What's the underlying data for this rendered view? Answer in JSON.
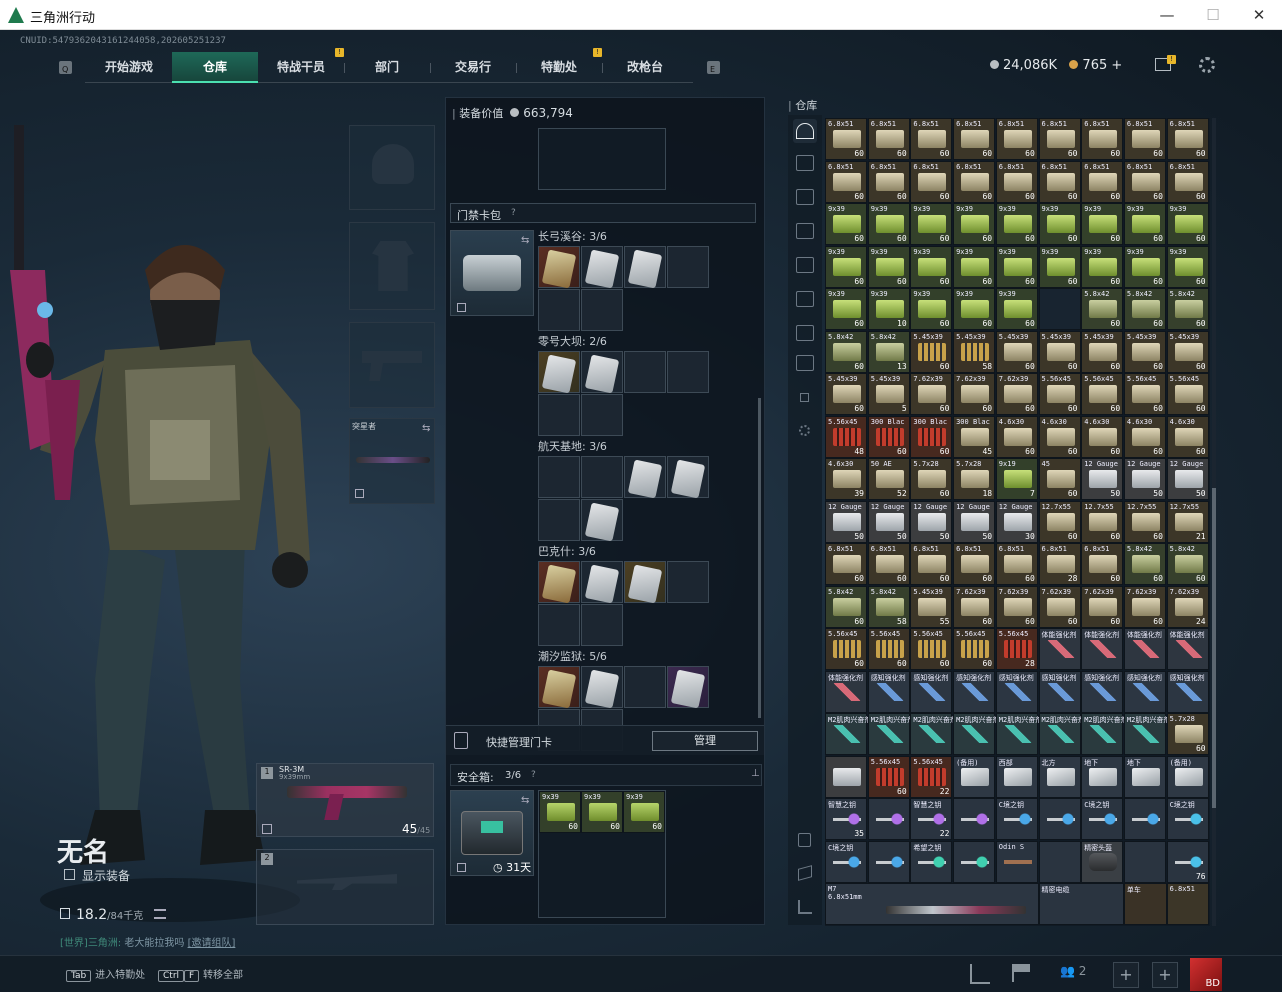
{
  "window": {
    "title": "三角洲行动",
    "min": "—",
    "max": "☐",
    "close": "✕"
  },
  "uid": "CNUID:5479362043161244058,202605251237",
  "nav": {
    "tabs": [
      {
        "label": "开始游戏",
        "active": false,
        "badge": ""
      },
      {
        "label": "仓库",
        "active": true,
        "badge": ""
      },
      {
        "label": "特战干员",
        "active": false,
        "badge": "!"
      },
      {
        "label": "部门",
        "active": false,
        "badge": ""
      },
      {
        "label": "交易行",
        "active": false,
        "badge": ""
      },
      {
        "label": "特勤处",
        "active": false,
        "badge": "!"
      },
      {
        "label": "改枪台",
        "active": false,
        "badge": ""
      }
    ],
    "left_key": "Q",
    "right_key": "E"
  },
  "currency": {
    "coins": "24,086K",
    "gold": "765",
    "plus": "+",
    "mail_badge": "!"
  },
  "player": {
    "name": "无名",
    "show_equipment": "显示装备",
    "weight": "18.2",
    "weight_max": "/84千克",
    "chat_channel": "[世界]",
    "chat_user": "三角洲:",
    "chat_text": "老大能拉我吗",
    "chat_link": "[邀请组队]"
  },
  "equipment": {
    "melee_label": "突星者"
  },
  "weapons": [
    {
      "slot": "1",
      "name": "SR-3M",
      "caliber": "9x39mm",
      "ammo": "45",
      "ammo_max": "/45"
    },
    {
      "slot": "2",
      "name": "",
      "caliber": "",
      "ammo": "",
      "ammo_max": ""
    }
  ],
  "middle": {
    "value_label": "装备价值",
    "value": "663,794",
    "keycard_title": "门禁卡包",
    "help": "?",
    "maps": [
      {
        "name": "长弓溪谷: 3/6",
        "cards": [
          "red",
          "white",
          "white"
        ]
      },
      {
        "name": "零号大坝: 2/6",
        "cards": [
          "gold",
          "white"
        ]
      },
      {
        "name": "航天基地: 3/6",
        "cards": [
          "",
          "",
          "white",
          "white",
          "",
          "white"
        ]
      },
      {
        "name": "巴克什: 3/6",
        "cards": [
          "red",
          "white",
          "gold"
        ]
      },
      {
        "name": "潮汐监狱: 5/6",
        "cards": [
          "red",
          "white",
          "",
          "purple"
        ]
      }
    ],
    "quick_manage": "快捷管理门卡",
    "manage_btn": "管理",
    "safebox": "安全箱:",
    "safebox_count": "3/6",
    "safebox_days": "31天",
    "safebox_items": [
      {
        "name": "9x39",
        "count": "60"
      },
      {
        "name": "9x39",
        "count": "60"
      },
      {
        "name": "9x39",
        "count": "60"
      }
    ]
  },
  "stash": {
    "title": "仓库",
    "rows": [
      [
        "6.8x51|60|ammo-tan",
        "6.8x51|60|ammo-tan",
        "6.8x51|60|ammo-tan",
        "6.8x51|60|ammo-tan",
        "6.8x51|60|ammo-tan",
        "6.8x51|60|ammo-tan",
        "6.8x51|60|ammo-tan",
        "6.8x51|60|ammo-tan",
        "6.8x51|60|ammo-tan"
      ],
      [
        "6.8x51|60|ammo-tan",
        "6.8x51|60|ammo-tan",
        "6.8x51|60|ammo-tan",
        "6.8x51|60|ammo-tan",
        "6.8x51|60|ammo-tan",
        "6.8x51|60|ammo-tan",
        "6.8x51|60|ammo-tan",
        "6.8x51|60|ammo-tan",
        "6.8x51|60|ammo-tan"
      ],
      [
        "9x39|60|ammo-green",
        "9x39|60|ammo-green",
        "9x39|60|ammo-green",
        "9x39|60|ammo-green",
        "9x39|60|ammo-green",
        "9x39|60|ammo-green",
        "9x39|60|ammo-green",
        "9x39|60|ammo-green",
        "9x39|60|ammo-green"
      ],
      [
        "9x39|60|ammo-green",
        "9x39|60|ammo-green",
        "9x39|60|ammo-green",
        "9x39|60|ammo-green",
        "9x39|60|ammo-green",
        "9x39|60|ammo-green",
        "9x39|60|ammo-green",
        "9x39|60|ammo-green",
        "9x39|60|ammo-green"
      ],
      [
        "9x39|60|ammo-green",
        "9x39|10|ammo-green",
        "9x39|60|ammo-green",
        "9x39|60|ammo-green",
        "9x39|60|ammo-green",
        "||empty",
        "5.8x42|60|ammo-olive",
        "5.8x42|60|ammo-olive",
        "5.8x42|60|ammo-olive"
      ],
      [
        "5.8x42|60|ammo-olive",
        "5.8x42|13|ammo-olive",
        "5.45x39|60|ammo-rod",
        "5.45x39|58|ammo-rod",
        "5.45x39|60|ammo-tan",
        "5.45x39|60|ammo-tan",
        "5.45x39|60|ammo-tan",
        "5.45x39|60|ammo-tan",
        "5.45x39|60|ammo-tan"
      ],
      [
        "5.45x39|60|ammo-tan",
        "5.45x39|5|ammo-tan",
        "7.62x39|60|ammo-tan",
        "7.62x39|60|ammo-tan",
        "7.62x39|60|ammo-tan",
        "5.56x45|60|ammo-tan",
        "5.56x45|60|ammo-tan",
        "5.56x45|60|ammo-tan",
        "5.56x45|60|ammo-tan"
      ],
      [
        "5.56x45|48|ammo-red",
        "300 Blac|60|ammo-red",
        "300 Blac|60|ammo-red",
        "300 Blac|45|ammo-tan",
        "4.6x30|60|ammo-tan",
        "4.6x30|60|ammo-tan",
        "4.6x30|60|ammo-tan",
        "4.6x30|60|ammo-tan",
        "4.6x30|60|ammo-tan"
      ],
      [
        "4.6x30|39|ammo-tan",
        "50 AE|52|ammo-tan",
        "5.7x28|60|ammo-tan",
        "5.7x28|18|ammo-tan",
        "9x19|7|ammo-green",
        "45|60|ammo-tan",
        "12 Gauge|50|ammo-box",
        "12 Gauge|50|ammo-box",
        "12 Gauge|50|ammo-box"
      ],
      [
        "12 Gauge|50|ammo-box",
        "12 Gauge|50|ammo-box",
        "12 Gauge|50|ammo-box",
        "12 Gauge|50|ammo-box",
        "12 Gauge|30|ammo-box",
        "12.7x55|60|ammo-tan",
        "12.7x55|60|ammo-tan",
        "12.7x55|60|ammo-tan",
        "12.7x55|21|ammo-tan"
      ],
      [
        "6.8x51|60|ammo-tan",
        "6.8x51|60|ammo-tan",
        "6.8x51|60|ammo-tan",
        "6.8x51|60|ammo-tan",
        "6.8x51|60|ammo-tan",
        "6.8x51|28|ammo-tan",
        "6.8x51|60|ammo-tan",
        "5.8x42|60|ammo-olive",
        "5.8x42|60|ammo-olive"
      ],
      [
        "5.8x42|60|ammo-olive",
        "5.8x42|58|ammo-olive",
        "5.45x39|55|ammo-tan",
        "7.62x39|60|ammo-tan",
        "7.62x39|60|ammo-tan",
        "7.62x39|60|ammo-tan",
        "7.62x39|60|ammo-tan",
        "7.62x39|60|ammo-tan",
        "7.62x39|24|ammo-tan"
      ],
      [
        "5.56x45|60|ammo-rod",
        "5.56x45|60|ammo-rod",
        "5.56x45|60|ammo-rod",
        "5.56x45|60|ammo-rod",
        "5.56x45|28|ammo-red",
        "体能强化剂||syringe-red",
        "体能强化剂||syringe-red",
        "体能强化剂||syringe-red",
        "体能强化剂||syringe-red"
      ],
      [
        "体能强化剂||syringe-red",
        "感知强化剂||syringe-blue",
        "感知强化剂||syringe-blue",
        "感知强化剂||syringe-blue",
        "感知强化剂||syringe-blue",
        "感知强化剂||syringe-blue",
        "感知强化剂||syringe-blue",
        "感知强化剂||syringe-blue",
        "感知强化剂||syringe-blue"
      ],
      [
        "M2肌肉兴奋剂||syringe-teal",
        "M2肌肉兴奋剂||syringe-teal",
        "M2肌肉兴奋剂||syringe-teal",
        "M2肌肉兴奋剂||syringe-teal",
        "M2肌肉兴奋剂||syringe-teal",
        "M2肌肉兴奋剂||syringe-teal",
        "M2肌肉兴奋剂||syringe-teal",
        "M2肌肉兴奋剂||syringe-teal",
        "5.7x28|60|ammo-tan"
      ],
      [
        "||ammo-box",
        "5.56x45|60|ammo-red",
        "5.56x45|22|ammo-red",
        "(备用)||card-white",
        "西部||card-white",
        "北方||card-white",
        "地下||card-white",
        "地下||card-white",
        "(备用)||card-white"
      ]
    ],
    "bottom_rows": [
      [
        "智慧之钥",
        "35",
        "key-purple"
      ],
      [
        "",
        "",
        "key-purple"
      ],
      [
        "智慧之钥",
        "22",
        "key-purple"
      ],
      [
        "",
        "",
        "key-purple"
      ],
      [
        "C境之钥",
        "",
        "key-blue"
      ],
      [
        "",
        "",
        "key-blue"
      ],
      [
        "C境之钥",
        "",
        "key-blue"
      ],
      [
        "",
        "",
        "key-blue"
      ],
      [
        "C境之钥",
        "",
        "key-blue2"
      ]
    ],
    "bottom_rows2": [
      [
        "C境之钥",
        "",
        "key-blue"
      ],
      [
        "",
        "",
        "key-blue"
      ],
      [
        "希望之钥",
        "",
        "key-teal"
      ],
      [
        "",
        "",
        "key-teal"
      ],
      [
        "Odin S",
        "",
        "rifle-small"
      ],
      [
        "",
        "",
        ""
      ],
      [
        "精密头盔",
        "",
        "helmet"
      ],
      [
        "",
        "",
        ""
      ],
      [
        "",
        "76",
        "key-blue2"
      ]
    ],
    "bottom_rows3": [
      [
        "M7",
        "6.8x51mm"
      ],
      [
        "精密电缆",
        ""
      ],
      [
        "单车",
        ""
      ],
      [
        "6.8x51",
        ""
      ]
    ]
  },
  "bottom": {
    "tab_key": "Tab",
    "tab_text": "进入特勤处",
    "ctrl_key": "Ctrl",
    "f_key": "F",
    "ctrl_text": "转移全部",
    "team_count": "2",
    "avatar_text": "BD"
  },
  "colors": {
    "accent": "#4be0b0",
    "nav_active": "#1e6958"
  }
}
